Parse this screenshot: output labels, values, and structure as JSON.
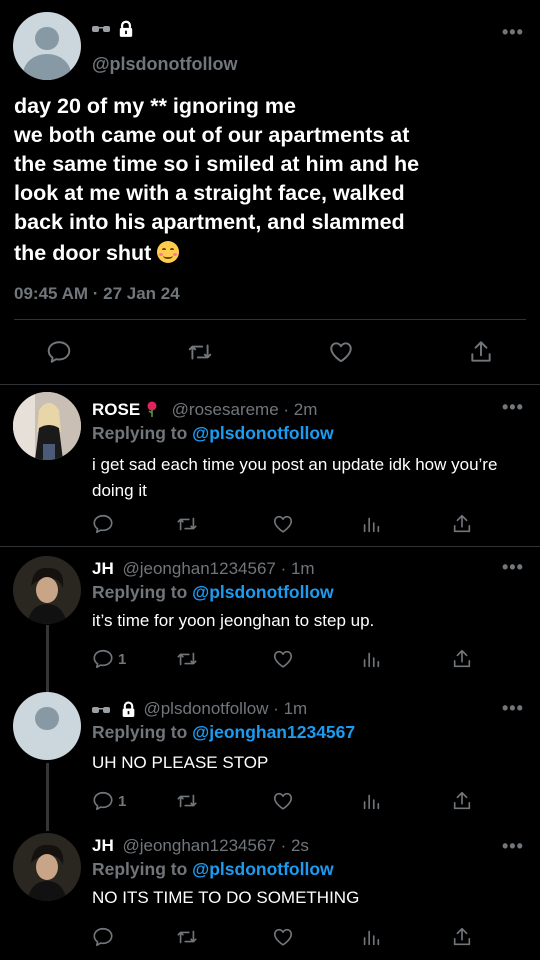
{
  "main_tweet": {
    "handle": "@plsdonotfollow",
    "text_lines": [
      "day 20 of my ** ignoring me",
      "we both came out of our apartments at",
      "the same time so i smiled at him and he",
      "look at me with a straight face, walked",
      "back into his apartment, and slammed",
      "the door shut"
    ],
    "timestamp": "09:45 AM · 27 Jan 24",
    "more_label": "•••"
  },
  "replies": [
    {
      "display_name": "ROSE",
      "handle_time": "@rosesareme · 2m",
      "replying_prefix": "Replying to",
      "replying_to": "@plsdonotfollow",
      "text": "i get sad each time you post an update idk how you’re doing it",
      "reply_count": "",
      "more_label": "•••"
    },
    {
      "display_name": "JH",
      "handle_time": "@jeonghan1234567 · 1m",
      "replying_prefix": "Replying to",
      "replying_to": "@plsdonotfollow",
      "text": "it’s time for yoon jeonghan to step up.",
      "reply_count": "1",
      "more_label": "•••"
    },
    {
      "display_name": "",
      "handle_time": "@plsdonotfollow · 1m",
      "replying_prefix": "Replying to",
      "replying_to": "@jeonghan1234567",
      "text": "UH NO PLEASE STOP",
      "reply_count": "1",
      "more_label": "•••"
    },
    {
      "display_name": "JH",
      "handle_time": "@jeonghan1234567 · 2s",
      "replying_prefix": "Replying to",
      "replying_to": "@plsdonotfollow",
      "text": "NO ITS TIME TO DO SOMETHING",
      "reply_count": "",
      "more_label": "•••"
    }
  ],
  "colors": {
    "background": "#000000",
    "accent_blue": "#1d9bf0",
    "muted_text": "#71767b",
    "rose_red": "#e0245e"
  },
  "icons": [
    "reply-icon",
    "retweet-icon",
    "like-icon",
    "views-icon",
    "share-icon",
    "lock-icon",
    "sunglasses-icon",
    "rose-icon",
    "smiling-face-emoji"
  ]
}
